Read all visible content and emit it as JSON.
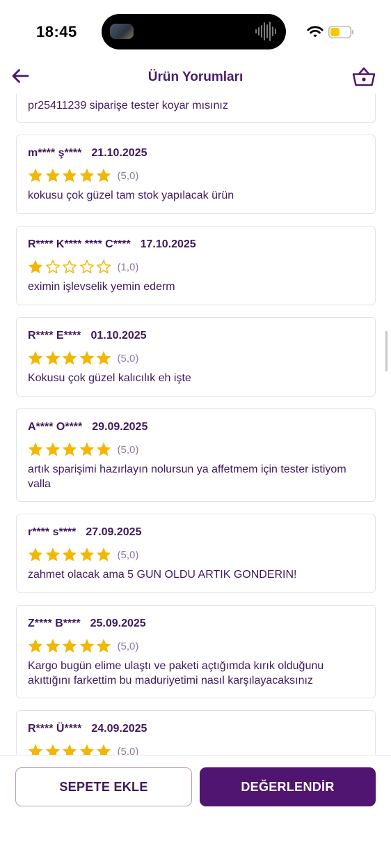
{
  "status_bar": {
    "time": "18:45",
    "battery_color": "#f7c600"
  },
  "header": {
    "title": "Ürün Yorumları",
    "back_icon": "arrow-left-icon",
    "basket_icon": "basket-icon"
  },
  "colors": {
    "accent": "#4f1570",
    "star": "#f2b705",
    "text": "#3d1a5c"
  },
  "partial_review": {
    "comment": "pr25411239 siparişe tester koyar mısınız"
  },
  "reviews": [
    {
      "author": "m**** ş****",
      "date": "21.10.2025",
      "rating": 5,
      "rating_label": "(5,0)",
      "comment": "kokusu çok güzel tam stok yapılacak ürün"
    },
    {
      "author": "R**** K**** **** C****",
      "date": "17.10.2025",
      "rating": 1,
      "rating_label": "(1,0)",
      "comment": "eximin işlevselik yemin ederm"
    },
    {
      "author": "R**** E****",
      "date": "01.10.2025",
      "rating": 5,
      "rating_label": "(5,0)",
      "comment": "Kokusu çok güzel kalıcılık eh işte"
    },
    {
      "author": "A**** O****",
      "date": "29.09.2025",
      "rating": 5,
      "rating_label": "(5,0)",
      "comment": "artık sparişimi hazırlayın nolursun ya affetmem için tester istiyom valla"
    },
    {
      "author": "r**** s****",
      "date": "27.09.2025",
      "rating": 5,
      "rating_label": "(5,0)",
      "comment": "zahmet olacak ama 5 GUN OLDU ARTIK GONDERIN!"
    },
    {
      "author": "Z**** B****",
      "date": "25.09.2025",
      "rating": 5,
      "rating_label": "(5,0)",
      "comment": "Kargo bugün elime ulaştı ve paketi açtığımda kırık olduğunu akıttığını farkettim  bu maduriyetimi nasıl karşılayacaksınız"
    },
    {
      "author": "R**** Ü****",
      "date": "24.09.2025",
      "rating": 5,
      "rating_label": "(5,0)",
      "comment": ""
    }
  ],
  "actions": {
    "add_to_cart": "SEPETE EKLE",
    "review": "DEĞERLENDİR"
  }
}
